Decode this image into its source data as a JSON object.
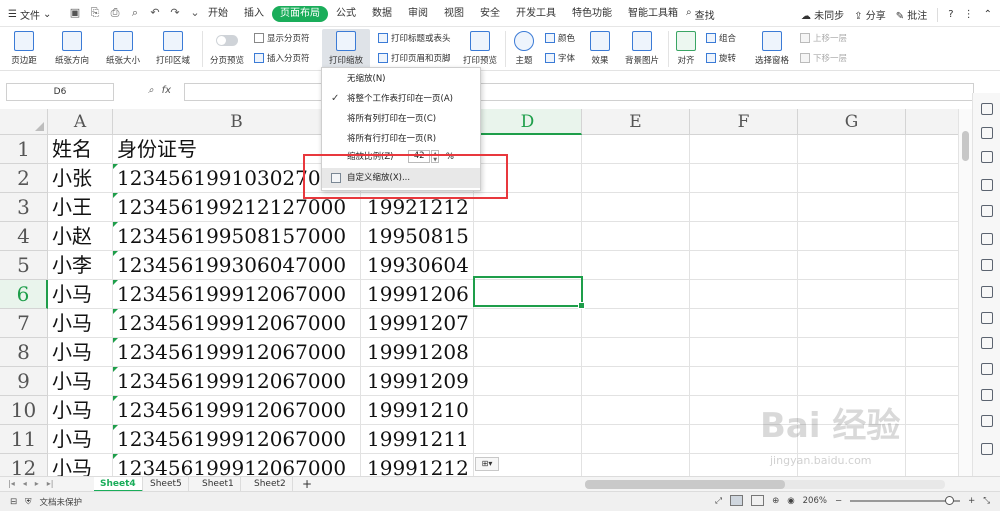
{
  "menu": {
    "file_label": "文件",
    "tabs": [
      "开始",
      "插入",
      "页面布局",
      "公式",
      "数据",
      "审阅",
      "视图",
      "安全",
      "开发工具",
      "特色功能",
      "智能工具箱"
    ],
    "active_tab": "页面布局",
    "search_label": "查找",
    "sync_label": "未同步",
    "share_label": "分享",
    "comment_label": "批注"
  },
  "ribbon": {
    "margins": "页边距",
    "orientation": "纸张方向",
    "size": "纸张大小",
    "print_area": "打印区域",
    "page_break_preview": "分页预览",
    "show_page_breaks": "显示分页符",
    "insert_page_break": "插入分页符",
    "print_scaling": "打印缩放",
    "print_titles": "打印标题或表头",
    "print_header_footer": "打印页眉和页脚",
    "print_preview": "打印预览",
    "theme": "主题",
    "colors": "颜色",
    "fonts": "字体",
    "effects": "效果",
    "background": "背景图片",
    "align": "对齐",
    "group": "组合",
    "rotate": "旋转",
    "selection_pane": "选择窗格",
    "bring_forward": "上移一层",
    "send_backward": "下移一层"
  },
  "formula_bar": {
    "cell_ref": "D6",
    "fx_label": "fx",
    "value": ""
  },
  "columns": [
    "A",
    "B",
    "C",
    "D",
    "E",
    "F",
    "G"
  ],
  "selected_column": "D",
  "rows": [
    {
      "num": "1",
      "a": "姓名",
      "b": "身份证号",
      "c": ""
    },
    {
      "num": "2",
      "a": "小张",
      "b": "123456199103027000",
      "c": ""
    },
    {
      "num": "3",
      "a": "小王",
      "b": "123456199212127000",
      "c": "19921212"
    },
    {
      "num": "4",
      "a": "小赵",
      "b": "123456199508157000",
      "c": "19950815"
    },
    {
      "num": "5",
      "a": "小李",
      "b": "123456199306047000",
      "c": "19930604"
    },
    {
      "num": "6",
      "a": "小马",
      "b": "123456199912067000",
      "c": "19991206"
    },
    {
      "num": "7",
      "a": "小马",
      "b": "123456199912067000",
      "c": "19991207"
    },
    {
      "num": "8",
      "a": "小马",
      "b": "123456199912067000",
      "c": "19991208"
    },
    {
      "num": "9",
      "a": "小马",
      "b": "123456199912067000",
      "c": "19991209"
    },
    {
      "num": "10",
      "a": "小马",
      "b": "123456199912067000",
      "c": "19991210"
    },
    {
      "num": "11",
      "a": "小马",
      "b": "123456199912067000",
      "c": "19991211"
    },
    {
      "num": "12",
      "a": "小马",
      "b": "123456199912067000",
      "c": "19991212"
    }
  ],
  "selected_row": "6",
  "dropdown": {
    "no_scaling": "无缩放(N)",
    "fit_sheet": "将整个工作表打印在一页(A)",
    "fit_columns": "将所有列打印在一页(C)",
    "fit_rows": "将所有行打印在一页(R)",
    "scale_label": "缩放比例(Z)",
    "scale_value": "42",
    "scale_unit": "%",
    "custom_scaling": "自定义缩放(X)..."
  },
  "sheets": [
    "Sheet4",
    "Sheet5",
    "Sheet1",
    "Sheet2"
  ],
  "active_sheet": "Sheet4",
  "status": {
    "protect": "文档未保护",
    "zoom": "206%"
  },
  "watermark": {
    "main": "Bai 经验",
    "sub": "jingyan.baidu.com"
  }
}
